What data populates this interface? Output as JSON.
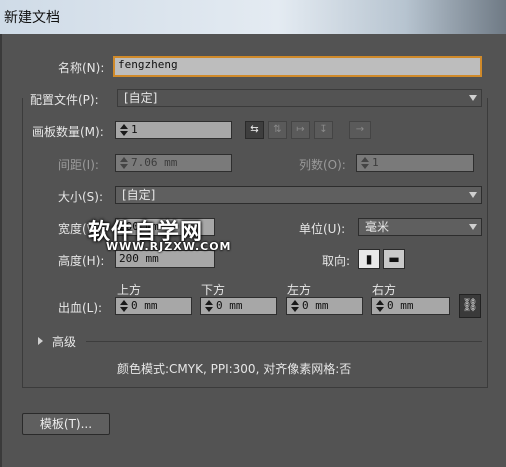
{
  "window": {
    "title": "新建文档"
  },
  "name_row": {
    "label": "名称(N):",
    "value": "fengzheng"
  },
  "profile_row": {
    "label": "配置文件(P):",
    "value": "[自定]"
  },
  "artboards": {
    "count_label": "画板数量(M):",
    "count_value": "1",
    "spacing_label": "间距(I):",
    "spacing_value": "7.06 mm",
    "columns_label": "列数(O):",
    "columns_value": "1",
    "arrow_glyph": "→"
  },
  "size_row": {
    "label": "大小(S):",
    "value": "[自定]"
  },
  "width_row": {
    "label": "宽度(W):",
    "value": "200 mm"
  },
  "units_row": {
    "label": "单位(U):",
    "value": "毫米"
  },
  "height_row": {
    "label": "高度(H):",
    "value": "200 mm"
  },
  "orientation_row": {
    "label": "取向:"
  },
  "bleed": {
    "label": "出血(L):",
    "top_label": "上方",
    "top_value": "0 mm",
    "bottom_label": "下方",
    "bottom_value": "0 mm",
    "left_label": "左方",
    "left_value": "0 mm",
    "right_label": "右方",
    "right_value": "0 mm"
  },
  "advanced": {
    "label": "高级"
  },
  "info": {
    "text": "颜色模式:CMYK, PPI:300, 对齐像素网格:否"
  },
  "buttons": {
    "template_label": "模板(T)..."
  },
  "watermark": {
    "text": "软件自学网",
    "sub": "WWW.RJZXW.COM"
  },
  "colors": {
    "dialog_bg": "#535353",
    "field_bg": "#a7a7a7",
    "focus_border": "#d08a2a"
  }
}
